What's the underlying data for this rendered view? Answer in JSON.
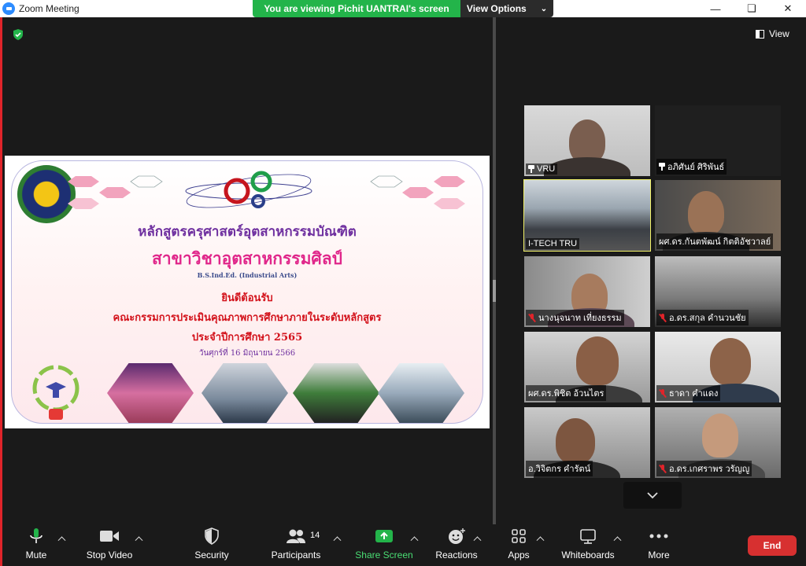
{
  "window": {
    "title": "Zoom Meeting",
    "share_banner": "You are viewing Pichit UANTRAI's screen",
    "view_options": "View Options"
  },
  "right_panel": {
    "view_label": "View"
  },
  "slide": {
    "line1": "หลักสูตรครุศาสตร์อุตสาหกรรมบัณฑิต",
    "line2": "สาขาวิชาอุตสาหกรรมศิลป์",
    "line3": "B.S.Ind.Ed. (Industrial Arts)",
    "line4": "ยินดีต้อนรับ",
    "line5": "คณะกรรมการประเมินคุณภาพการศึกษาภายในระดับหลักสูตร",
    "line6": "ประจำปีการศึกษา 2565",
    "line7": "วันศุกร์ที่ 16 มิถุนายน 2566"
  },
  "participants": [
    {
      "name": "VRU",
      "icon": "pin-icon"
    },
    {
      "name": "อภิศันย์ ศิริพันธ์",
      "icon": "pin-icon"
    },
    {
      "name": "I-TECH TRU",
      "icon": ""
    },
    {
      "name": "ผศ.ดร.กันตพัฒน์ กิตติอัชวาลย์",
      "icon": ""
    },
    {
      "name": "นางนุจนาท เที่ยงธรรม",
      "icon": "mic-off-icon"
    },
    {
      "name": "อ.ดร.สกุล คำนวนชัย",
      "icon": "mic-off-icon"
    },
    {
      "name": "ผศ.ดร.พิชิต อ้วนไตร",
      "icon": ""
    },
    {
      "name": "ธาดา คำแดง",
      "icon": "mic-off-icon"
    },
    {
      "name": "อ.วิจิตกร คำรัตน์",
      "icon": ""
    },
    {
      "name": "อ.ดร.เกศราพร วรัญญู",
      "icon": "mic-off-icon"
    }
  ],
  "toolbar": {
    "mute": "Mute",
    "stop_video": "Stop Video",
    "security": "Security",
    "participants": "Participants",
    "participant_count": "14",
    "share_screen": "Share Screen",
    "reactions": "Reactions",
    "apps": "Apps",
    "whiteboards": "Whiteboards",
    "more": "More",
    "end": "End"
  },
  "colors": {
    "share_green": "#23b44a",
    "active_speaker": "#f3f369",
    "end_red": "#d73030"
  }
}
